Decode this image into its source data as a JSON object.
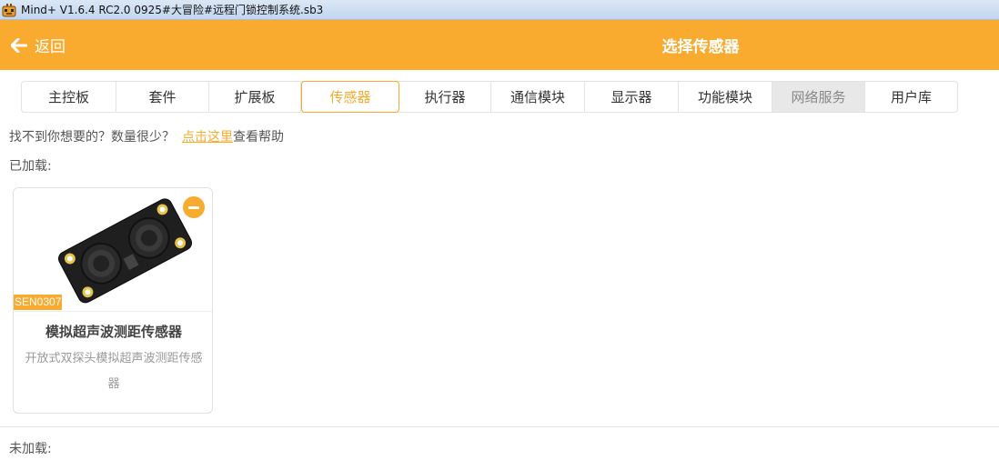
{
  "window": {
    "title": "Mind+ V1.6.4 RC2.0   0925#大冒险#远程门锁控制系统.sb3",
    "icon": "mind-plus-app-icon"
  },
  "header": {
    "back_label": "返回",
    "title": "选择传感器",
    "accent_color": "#f8ab2f"
  },
  "tabs": [
    {
      "label": "主控板",
      "state": "normal"
    },
    {
      "label": "套件",
      "state": "normal"
    },
    {
      "label": "扩展板",
      "state": "normal"
    },
    {
      "label": "传感器",
      "state": "active"
    },
    {
      "label": "执行器",
      "state": "normal"
    },
    {
      "label": "通信模块",
      "state": "normal"
    },
    {
      "label": "显示器",
      "state": "normal"
    },
    {
      "label": "功能模块",
      "state": "normal"
    },
    {
      "label": "网络服务",
      "state": "disabled"
    },
    {
      "label": "用户库",
      "state": "normal"
    }
  ],
  "help": {
    "prefix": "找不到你想要的？数量很少？",
    "link": "点击这里",
    "suffix": "查看帮助"
  },
  "sections": {
    "loaded_label": "已加载:",
    "unloaded_label": "未加载:"
  },
  "loaded_items": [
    {
      "sku": "SEN0307",
      "title": "模拟超声波测距传感器",
      "description": "开放式双探头模拟超声波测距传感器",
      "image": "ultrasonic-sensor-board"
    }
  ]
}
